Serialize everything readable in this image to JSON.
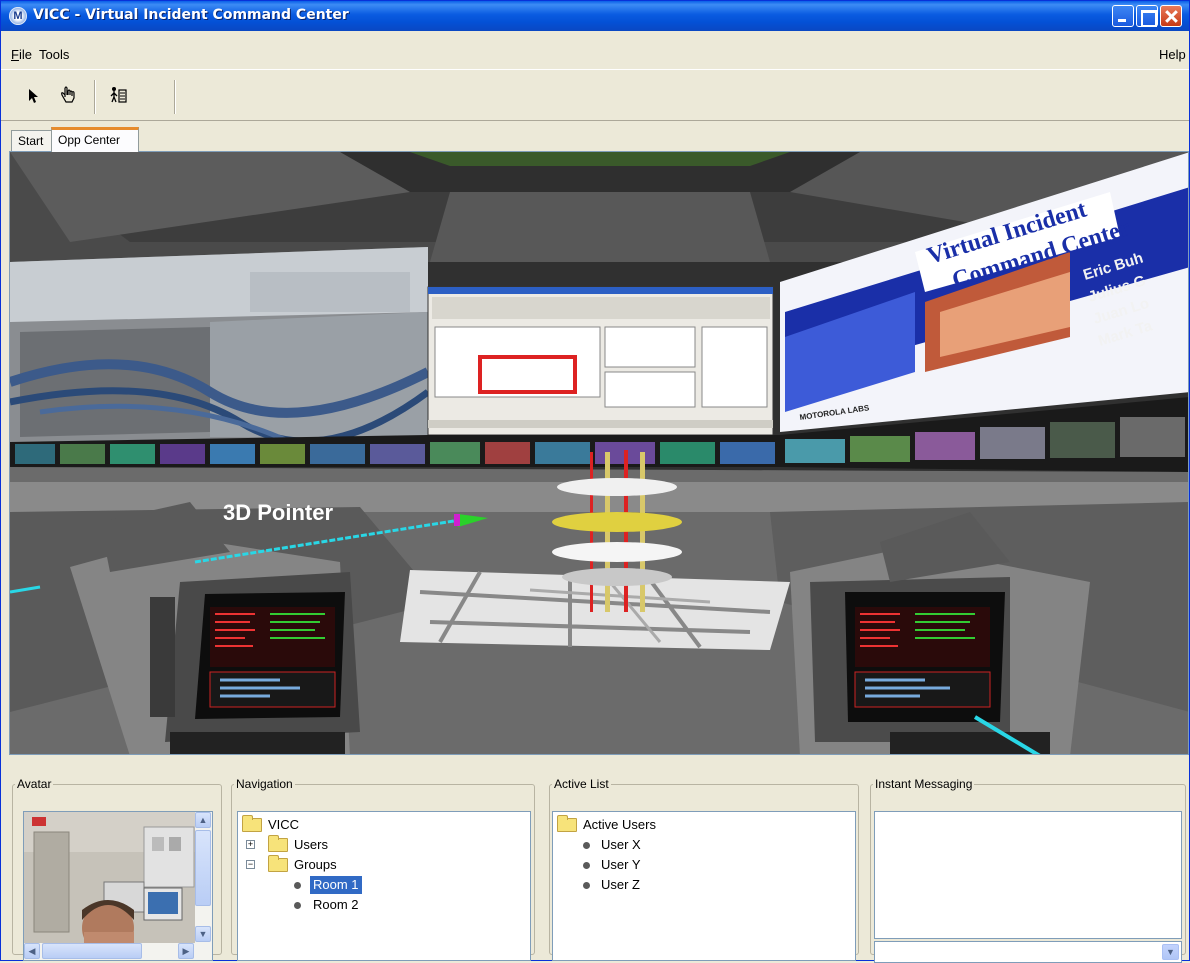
{
  "window": {
    "title": "VICC - Virtual Incident Command Center",
    "logo_glyph": "M"
  },
  "menu": {
    "file": "File",
    "tools": "Tools",
    "help": "Help"
  },
  "toolbar": {
    "icons": [
      "arrow-pointer-icon",
      "hand-icon",
      "navigate-figure-icon"
    ]
  },
  "tabs": [
    {
      "label": "Start"
    },
    {
      "label": "Opp Center",
      "active": true
    }
  ],
  "scene": {
    "pointer_label": "3D Pointer",
    "slide_lines": [
      "Virtual Incident",
      "Command Center"
    ],
    "slide_names": [
      "Eric Buh",
      "Julius G",
      "Juan Lo",
      "Mark Ta"
    ],
    "slide_footer": "MOTOROLA LABS"
  },
  "panels": {
    "avatar": {
      "legend": "Avatar"
    },
    "navigation": {
      "legend": "Navigation",
      "root": "VICC",
      "users": "Users",
      "groups": "Groups",
      "rooms": [
        "Room 1",
        "Room 2"
      ],
      "selected_room": "Room 1"
    },
    "active_list": {
      "legend": "Active List",
      "root": "Active Users",
      "users": [
        "User X",
        "User Y",
        "User Z"
      ]
    },
    "instant_messaging": {
      "legend": "Instant Messaging"
    }
  },
  "colors": {
    "title_bar": "#0a5be1",
    "selection": "#316ac5",
    "tab_accent": "#e68b2c",
    "pointer_ray": "#29d7e6"
  }
}
